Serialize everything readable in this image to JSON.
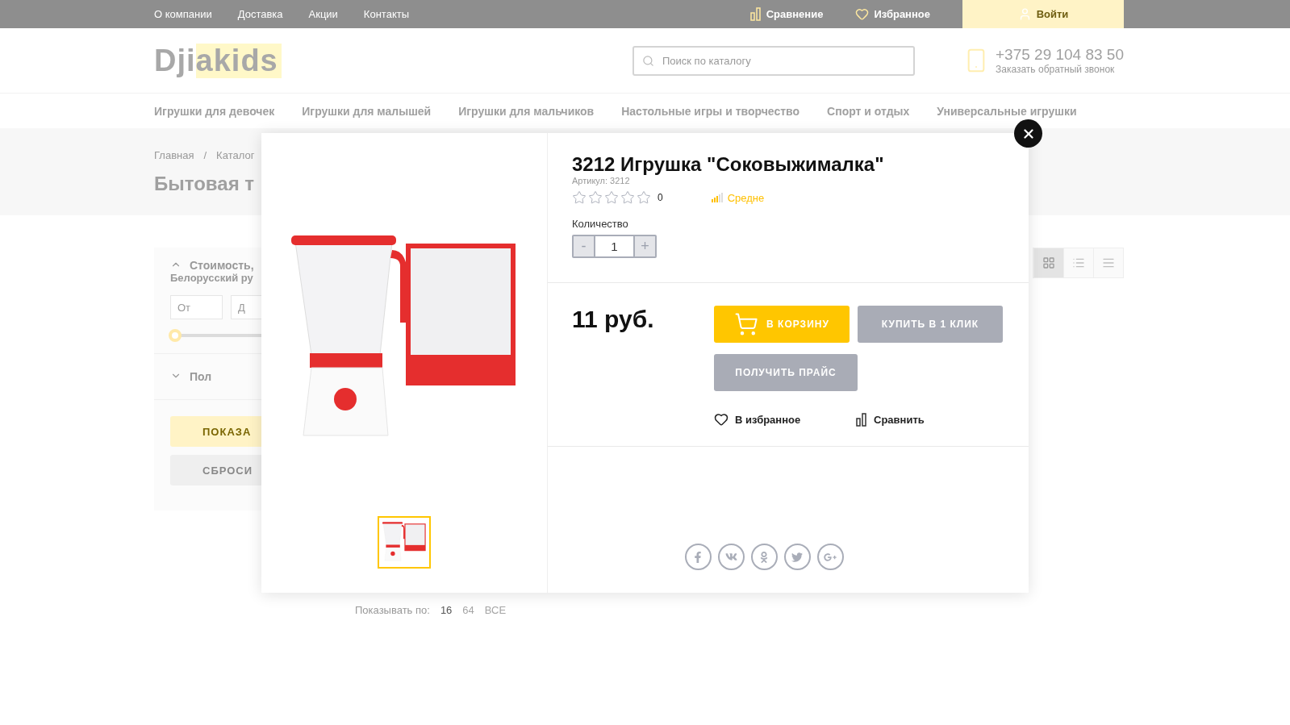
{
  "top_bar": {
    "links": [
      "О компании",
      "Доставка",
      "Акции",
      "Контакты"
    ],
    "compare": "Сравнение",
    "favorites": "Избранное",
    "login": "Войти"
  },
  "header": {
    "logo": {
      "plain": "Dji",
      "highlighted": "akids"
    },
    "search": {
      "placeholder": "Поиск по каталогу"
    },
    "phone": "+375 29 104 83 50",
    "callback": "Заказать обратный звонок"
  },
  "nav": [
    "Игрушки для девочек",
    "Игрушки для малышей",
    "Игрушки для мальчиков",
    "Настольные игры и творчество",
    "Спорт и отдых",
    "Универсальные игрушки"
  ],
  "breadcrumbs": [
    "Главная",
    "Каталог"
  ],
  "breadcrumb_separator": "/",
  "page_title": "Бытовая т",
  "filter": {
    "sections": [
      {
        "title": "Стоимость,",
        "subtitle": "Белорусский ру",
        "expanded": true
      },
      {
        "title": "Пол",
        "expanded": false
      }
    ],
    "from_label": "От",
    "to_label": "Д",
    "price_slider": {
      "level": 0
    },
    "apply": "ПОКАЗА",
    "reset": "СБРОСИ"
  },
  "view_modes": [
    {
      "kind": "grid",
      "selected": true
    },
    {
      "kind": "list",
      "selected": false
    },
    {
      "kind": "compact",
      "selected": false
    }
  ],
  "pagination": {
    "label": "Показывать по:",
    "options": [
      {
        "label": "16",
        "selected": true
      },
      {
        "label": "64",
        "selected": false
      },
      {
        "label": "ВСЕ",
        "selected": false
      }
    ]
  },
  "modal": {
    "title": "3212 Игрушка \"Соковыжималка\"",
    "article": "Артикул: 3212",
    "stars": 0,
    "reviews": "0",
    "stock": "Средне",
    "quantity_label": "Количество",
    "quantity": "1",
    "minus": "-",
    "plus": "+",
    "price": "11 руб.",
    "add_to_cart": "В КОРЗИНУ",
    "buy_one_click": "КУПИТЬ В 1 КЛИК",
    "get_price": "ПОЛУЧИТЬ ПРАЙС",
    "to_favorites": "В избранное",
    "compare": "Сравнить",
    "thumbnails": [
      {
        "selected": true
      }
    ],
    "social": [
      {
        "kind": "facebook"
      },
      {
        "kind": "vk"
      },
      {
        "kind": "ok"
      },
      {
        "kind": "twitter"
      },
      {
        "kind": "googleplus"
      }
    ]
  }
}
